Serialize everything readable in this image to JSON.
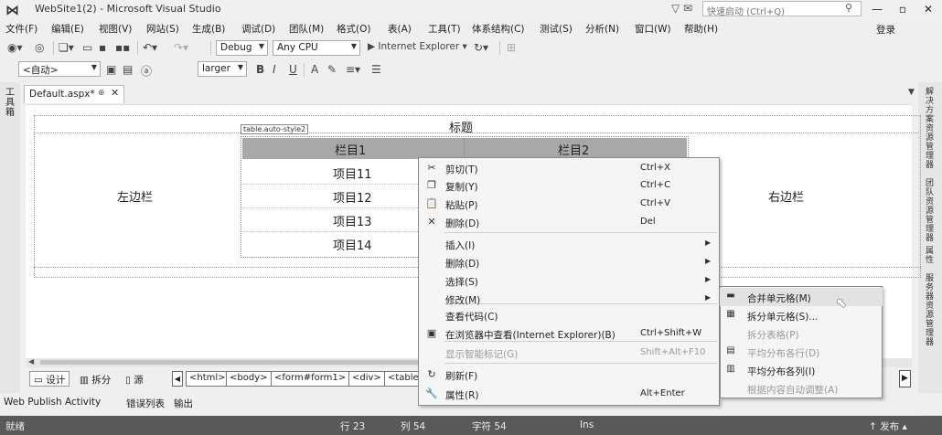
{
  "window": {
    "title": "WebSite1(2) - Microsoft Visual Studio",
    "quick_launch_placeholder": "快速启动 (Ctrl+Q)",
    "minimize": "—",
    "restore": "▫",
    "close": "✕"
  },
  "menubar": {
    "items": [
      "文件(F)",
      "编辑(E)",
      "视图(V)",
      "网站(S)",
      "生成(B)",
      "调试(D)",
      "团队(M)",
      "格式(O)",
      "表(A)",
      "工具(T)",
      "体系结构(C)",
      "测试(S)",
      "分析(N)",
      "窗口(W)",
      "帮助(H)"
    ],
    "signin": "登录"
  },
  "toolbar1": {
    "config": "Debug",
    "platform": "Any CPU",
    "browser": "▶ Internet Explorer ▾"
  },
  "toolbar2": {
    "style": "<自动>",
    "font_size": "larger",
    "bold": "B",
    "italic": "I",
    "underline": "U"
  },
  "side_left": {
    "toolbox": "工具箱"
  },
  "side_right": {
    "tabs": [
      "解决方案资源管理器",
      "团队资源管理器",
      "属性",
      "服务器资源管理器"
    ]
  },
  "doc_tab": {
    "name": "Default.aspx*",
    "pin": "⊕",
    "close": "✕"
  },
  "design": {
    "heading": "标题",
    "left_sidebar": "左边栏",
    "right_sidebar": "右边栏",
    "table_tag": "table.auto-style2",
    "col1": "栏目1",
    "col2": "栏目2",
    "items": [
      "项目11",
      "项目12",
      "项目13",
      "项目14"
    ]
  },
  "viewbar": {
    "design": "设计",
    "split": "拆分",
    "source": "源",
    "breadcrumbs": [
      "<html>",
      "<body>",
      "<form#form1>",
      "<div>",
      "<table."
    ]
  },
  "bottom_tabs": [
    "Web Publish Activity",
    "错误列表",
    "输出"
  ],
  "status": {
    "ready": "就绪",
    "line": "行 23",
    "col": "列 54",
    "char": "字符 54",
    "mode": "Ins",
    "publish": "↑ 发布 ▴"
  },
  "context_menu": {
    "items": [
      {
        "icon": "✂",
        "label": "剪切(T)",
        "shortcut": "Ctrl+X",
        "enabled": true,
        "submenu": false
      },
      {
        "icon": "❐",
        "label": "复制(Y)",
        "shortcut": "Ctrl+C",
        "enabled": true,
        "submenu": false
      },
      {
        "icon": "📋",
        "label": "粘贴(P)",
        "shortcut": "Ctrl+V",
        "enabled": true,
        "submenu": false
      },
      {
        "icon": "✕",
        "label": "删除(D)",
        "shortcut": "Del",
        "enabled": true,
        "submenu": false
      },
      {
        "icon": "",
        "label": "插入(I)",
        "shortcut": "",
        "enabled": true,
        "submenu": true
      },
      {
        "icon": "",
        "label": "删除(D)",
        "shortcut": "",
        "enabled": true,
        "submenu": true
      },
      {
        "icon": "",
        "label": "选择(S)",
        "shortcut": "",
        "enabled": true,
        "submenu": true
      },
      {
        "icon": "",
        "label": "修改(M)",
        "shortcut": "",
        "enabled": true,
        "submenu": true
      },
      {
        "icon": "",
        "label": "查看代码(C)",
        "shortcut": "",
        "enabled": true,
        "submenu": false
      },
      {
        "icon": "▣",
        "label": "在浏览器中查看(Internet Explorer)(B)",
        "shortcut": "Ctrl+Shift+W",
        "enabled": true,
        "submenu": false
      },
      {
        "icon": "",
        "label": "显示智能标记(G)",
        "shortcut": "Shift+Alt+F10",
        "enabled": false,
        "submenu": false
      },
      {
        "icon": "↻",
        "label": "刷新(F)",
        "shortcut": "",
        "enabled": true,
        "submenu": false
      },
      {
        "icon": "🔧",
        "label": "属性(R)",
        "shortcut": "Alt+Enter",
        "enabled": true,
        "submenu": false
      }
    ]
  },
  "submenu": {
    "items": [
      {
        "icon": "▬",
        "label": "合并单元格(M)",
        "enabled": true,
        "highlighted": true
      },
      {
        "icon": "▦",
        "label": "拆分单元格(S)...",
        "enabled": true,
        "highlighted": false
      },
      {
        "icon": "",
        "label": "拆分表格(P)",
        "enabled": false,
        "highlighted": false
      },
      {
        "icon": "▤",
        "label": "平均分布各行(D)",
        "enabled": false,
        "highlighted": false
      },
      {
        "icon": "▥",
        "label": "平均分布各列(I)",
        "enabled": true,
        "highlighted": false
      },
      {
        "icon": "",
        "label": "根据内容自动调整(A)",
        "enabled": false,
        "highlighted": false
      }
    ]
  }
}
